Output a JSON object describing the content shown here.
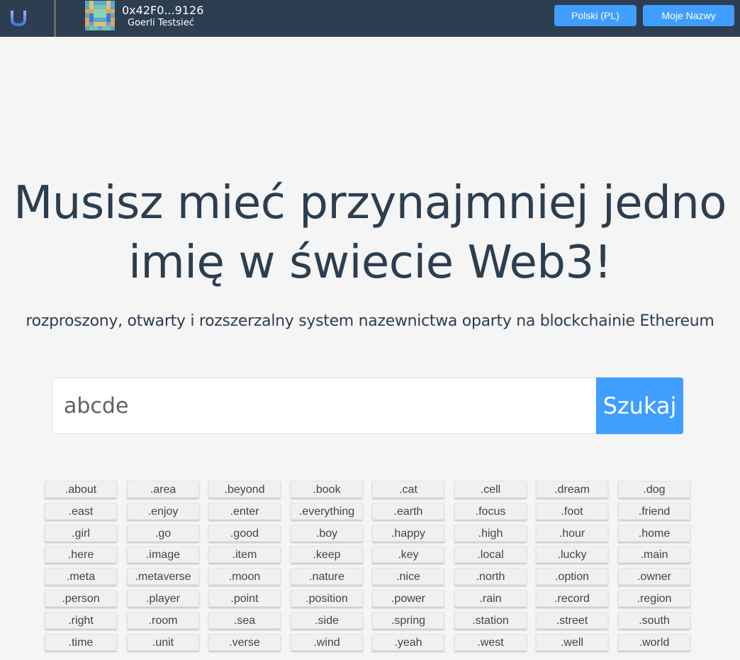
{
  "header": {
    "address": "0x42F0...9126",
    "network": "Goerli Testsieć",
    "language_button": "Polski (PL)",
    "my_names_button": "Moje Nazwy"
  },
  "hero": {
    "line1": "Musisz mieć przynajmniej jedno",
    "line2": "imię w świecie Web3!",
    "subtitle": "rozproszony, otwarty i rozszerzalny system nazewnictwa oparty na blockchainie Ethereum"
  },
  "search": {
    "value": "abcde",
    "button_label": "Szukaj"
  },
  "tlds": [
    ".about",
    ".area",
    ".beyond",
    ".book",
    ".cat",
    ".cell",
    ".dream",
    ".dog",
    ".east",
    ".enjoy",
    ".enter",
    ".everything",
    ".earth",
    ".focus",
    ".foot",
    ".friend",
    ".girl",
    ".go",
    ".good",
    ".boy",
    ".happy",
    ".high",
    ".hour",
    ".home",
    ".here",
    ".image",
    ".item",
    ".keep",
    ".key",
    ".local",
    ".lucky",
    ".main",
    ".meta",
    ".metaverse",
    ".moon",
    ".nature",
    ".nice",
    ".north",
    ".option",
    ".owner",
    ".person",
    ".player",
    ".point",
    ".position",
    ".power",
    ".rain",
    ".record",
    ".region",
    ".right",
    ".room",
    ".sea",
    ".side",
    ".spring",
    ".station",
    ".street",
    ".south",
    ".time",
    ".unit",
    ".verse",
    ".wind",
    ".yeah",
    ".west",
    ".well",
    ".world"
  ],
  "colors": {
    "header_bg": "#2c3e50",
    "accent": "#409eff",
    "text": "#2c3e50",
    "page_bg": "#f5f5f5"
  }
}
